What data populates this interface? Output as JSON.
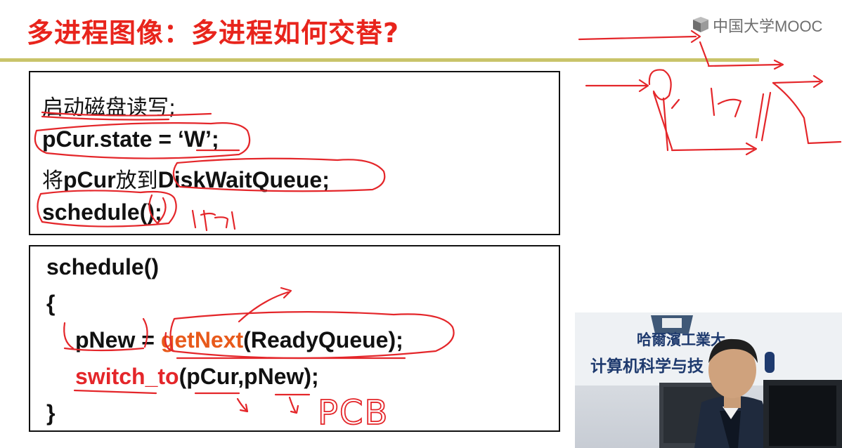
{
  "slide": {
    "title": "多进程图像：多进程如何交替?",
    "brand": {
      "text": "中国大学MOOC",
      "icon": "mooc-logo-icon"
    },
    "box1": {
      "line1": "启动磁盘读写;",
      "line2": "pCur.state = ‘W’;",
      "line3_cjk_a": "将",
      "line3_code_a": "pCur",
      "line3_cjk_b": "放到",
      "line3_code_b": "DiskWaitQueue;",
      "line4": "schedule();"
    },
    "box2": {
      "line1": "schedule()",
      "line2": "{",
      "line3_a": "pNew = ",
      "line3_fn": "getNext",
      "line3_b": "(ReadyQueue);",
      "line4_fn": "switch_to",
      "line4_b": "(pCur,pNew);",
      "line5": "}"
    },
    "video": {
      "banner_line1": "哈爾濱工業大",
      "banner_line2": "计算机科学与技"
    },
    "annotations": {
      "pcb": "PCB",
      "switch_mark": "切"
    },
    "colors": {
      "title": "#e8241c",
      "rule": "#c9c46a",
      "ink": "#e4262a",
      "highlight_fn": "#e85a1b"
    }
  }
}
